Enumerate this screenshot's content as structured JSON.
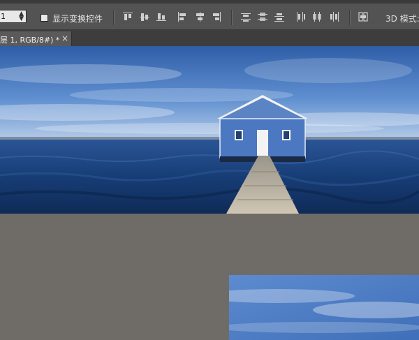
{
  "options_bar": {
    "select_value": "1",
    "show_transform_controls_label": "显示变换控件",
    "show_transform_controls_checked": false,
    "mode_label": "3D 模式:"
  },
  "document_tab": {
    "title": "层 1, RGB/8#) *",
    "close_glyph": "×"
  },
  "colors": {
    "panel_bg": "#535353",
    "tabbar_bg": "#3d3d3d",
    "canvas_bg": "#6f6c68",
    "sky_blue": "#3f6fb8",
    "water_blue": "#183f78",
    "house_blue": "#4b78c0"
  }
}
